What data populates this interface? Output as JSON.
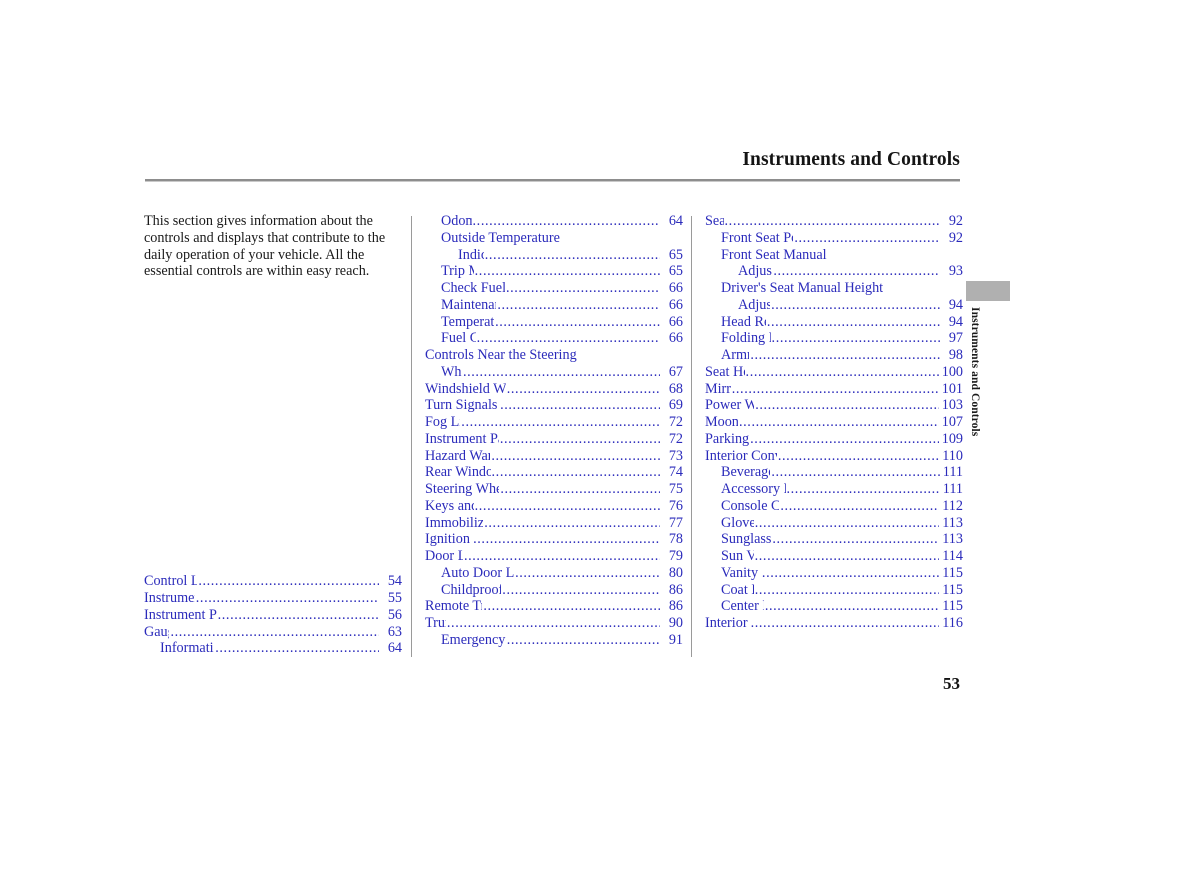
{
  "document": {
    "chapter_title": "Instruments and Controls",
    "page_number": "53",
    "side_tab_label": "Instruments and Controls"
  },
  "intro": {
    "paragraph": "This section gives information about the controls and displays that contribute to the daily operation of your vehicle. All the essential controls are within easy reach."
  },
  "columns": [
    {
      "id": "column-1",
      "entries": [
        {
          "label": "Control Locations",
          "page": "54",
          "indent": 0
        },
        {
          "label": "Instrument Panel",
          "page": "55",
          "indent": 0
        },
        {
          "label": "Instrument Panel Indicators",
          "page": "56",
          "indent": 0
        },
        {
          "label": "Gauges",
          "page": "63",
          "indent": 0
        },
        {
          "label": "Information Display",
          "page": "64",
          "indent": 1
        }
      ]
    },
    {
      "id": "column-2",
      "entries": [
        {
          "label": "Odometer",
          "page": "64",
          "indent": 1
        },
        {
          "label": "Outside Temperature",
          "page": "",
          "indent": 1,
          "continuation": true
        },
        {
          "label": "Indicator",
          "page": "65",
          "indent": 2
        },
        {
          "label": "Trip Meter",
          "page": "65",
          "indent": 1
        },
        {
          "label": "Check Fuel Cap Message",
          "page": "66",
          "indent": 1
        },
        {
          "label": "Maintenance Minder",
          "page": "66",
          "indent": 1
        },
        {
          "label": "Temperature Gauge",
          "page": "66",
          "indent": 1
        },
        {
          "label": "Fuel Gauge",
          "page": "66",
          "indent": 1
        },
        {
          "label": "Controls Near the Steering",
          "page": "",
          "indent": 0,
          "continuation": true
        },
        {
          "label": "Wheel",
          "page": "67",
          "indent": 1
        },
        {
          "label": "Windshield Wipers and Washers",
          "page": "68",
          "indent": 0
        },
        {
          "label": "Turn Signals and Headlights",
          "page": "69",
          "indent": 0
        },
        {
          "label": "Fog Lights",
          "page": "72",
          "indent": 0
        },
        {
          "label": "Instrument Panel Brightness",
          "page": "72",
          "indent": 0
        },
        {
          "label": "Hazard Warning Button",
          "page": "73",
          "indent": 0
        },
        {
          "label": "Rear Window Defogger",
          "page": "74",
          "indent": 0
        },
        {
          "label": "Steering Wheel Adjustments",
          "page": "75",
          "indent": 0
        },
        {
          "label": "Keys and Locks",
          "page": "76",
          "indent": 0
        },
        {
          "label": "Immobilizer System",
          "page": "77",
          "indent": 0
        },
        {
          "label": "Ignition Switch",
          "page": "78",
          "indent": 0
        },
        {
          "label": "Door Locks",
          "page": "79",
          "indent": 0
        },
        {
          "label": "Auto Door Locking/Unlocking",
          "page": "80",
          "indent": 1
        },
        {
          "label": "Childproof Door Locks",
          "page": "86",
          "indent": 1
        },
        {
          "label": "Remote Transmitter",
          "page": "86",
          "indent": 0
        },
        {
          "label": "Trunk",
          "page": "90",
          "indent": 0
        },
        {
          "label": "Emergency Trunk Opener",
          "page": "91",
          "indent": 1
        }
      ]
    },
    {
      "id": "column-3",
      "entries": [
        {
          "label": "Seats",
          "page": "92",
          "indent": 0
        },
        {
          "label": "Front Seat Power Adjustments",
          "page": "92",
          "indent": 1
        },
        {
          "label": "Front Seat Manual",
          "page": "",
          "indent": 1,
          "continuation": true
        },
        {
          "label": "Adjustments",
          "page": "93",
          "indent": 2
        },
        {
          "label": "Driver's Seat Manual Height",
          "page": "",
          "indent": 1,
          "continuation": true
        },
        {
          "label": "Adjustment",
          "page": "94",
          "indent": 2
        },
        {
          "label": "Head Restraints",
          "page": "94",
          "indent": 1
        },
        {
          "label": "Folding Rear Seat",
          "page": "97",
          "indent": 1
        },
        {
          "label": "Armrests",
          "page": "98",
          "indent": 1
        },
        {
          "label": "Seat Heaters",
          "page": "100",
          "indent": 0
        },
        {
          "label": "Mirrors",
          "page": "101",
          "indent": 0
        },
        {
          "label": "Power Windows",
          "page": "103",
          "indent": 0
        },
        {
          "label": "Moonroof",
          "page": "107",
          "indent": 0
        },
        {
          "label": "Parking Brake",
          "page": "109",
          "indent": 0
        },
        {
          "label": "Interior Convenience Items",
          "page": "110",
          "indent": 0
        },
        {
          "label": "Beverage Holders",
          "page": "111",
          "indent": 1
        },
        {
          "label": "Accessory Power Sockets",
          "page": "111",
          "indent": 1
        },
        {
          "label": "Console Compartment",
          "page": "112",
          "indent": 1
        },
        {
          "label": "Glove Box",
          "page": "113",
          "indent": 1
        },
        {
          "label": "Sunglasses Holder",
          "page": "113",
          "indent": 1
        },
        {
          "label": "Sun Visors",
          "page": "114",
          "indent": 1
        },
        {
          "label": "Vanity Mirror",
          "page": "115",
          "indent": 1
        },
        {
          "label": "Coat Hook",
          "page": "115",
          "indent": 1
        },
        {
          "label": "Center Pockets",
          "page": "115",
          "indent": 1
        },
        {
          "label": "Interior Lights",
          "page": "116",
          "indent": 0
        }
      ]
    }
  ],
  "colors": {
    "toc_text": "#2b2bbb",
    "body_text": "#1a1a1a",
    "rule": "#8d8d8d",
    "side_tab_box": "#b0b0b0"
  }
}
